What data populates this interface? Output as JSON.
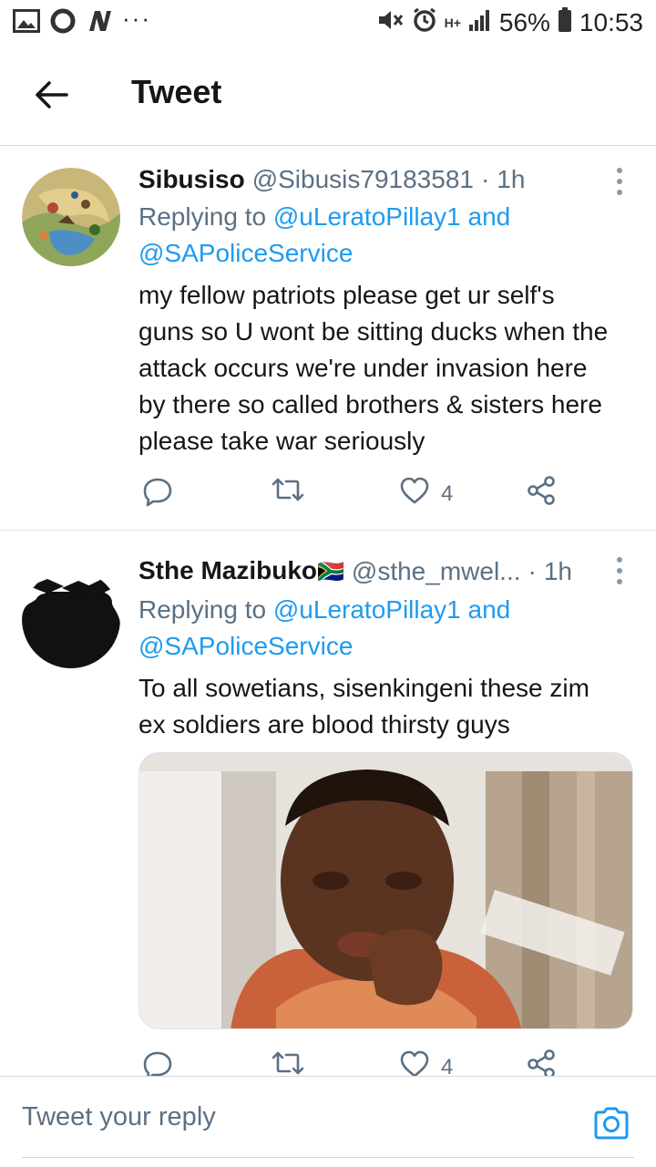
{
  "status_bar": {
    "battery": "56%",
    "time": "10:53",
    "network": "H+",
    "left_icons": [
      "gallery-icon",
      "o-icon",
      "n-icon",
      "more-dots-icon"
    ],
    "right_icons": [
      "mute-icon",
      "alarm-icon",
      "signal-icon",
      "battery-icon"
    ]
  },
  "header": {
    "title": "Tweet"
  },
  "tweets": [
    {
      "name": "Sibusiso",
      "handle": "@Sibusis79183581",
      "time": "1h",
      "replying_prefix": "Replying to",
      "replying_user1": "@uLeratoPillay1",
      "replying_and": "and",
      "replying_user2": "@SAPoliceService",
      "text": "my fellow patriots please get ur self's guns so U wont be sitting ducks when the attack occurs we're under invasion here by there so called brothers & sisters here please take war seriously",
      "likes": "4"
    },
    {
      "name": "Sthe Mazibuko",
      "flag": "🇿🇦",
      "handle": "@sthe_mwel...",
      "time": "1h",
      "replying_prefix": "Replying to",
      "replying_user1": "@uLeratoPillay1",
      "replying_and": "and",
      "replying_user2": "@SAPoliceService",
      "text": "To all sowetians, sisenkingeni these zim ex soldiers are blood thirsty guys",
      "likes": "4"
    }
  ],
  "reply_bar": {
    "placeholder": "Tweet your reply"
  },
  "colors": {
    "link": "#1d9bf0",
    "secondary_text": "#5b7083",
    "divider": "#e1e6ea"
  }
}
